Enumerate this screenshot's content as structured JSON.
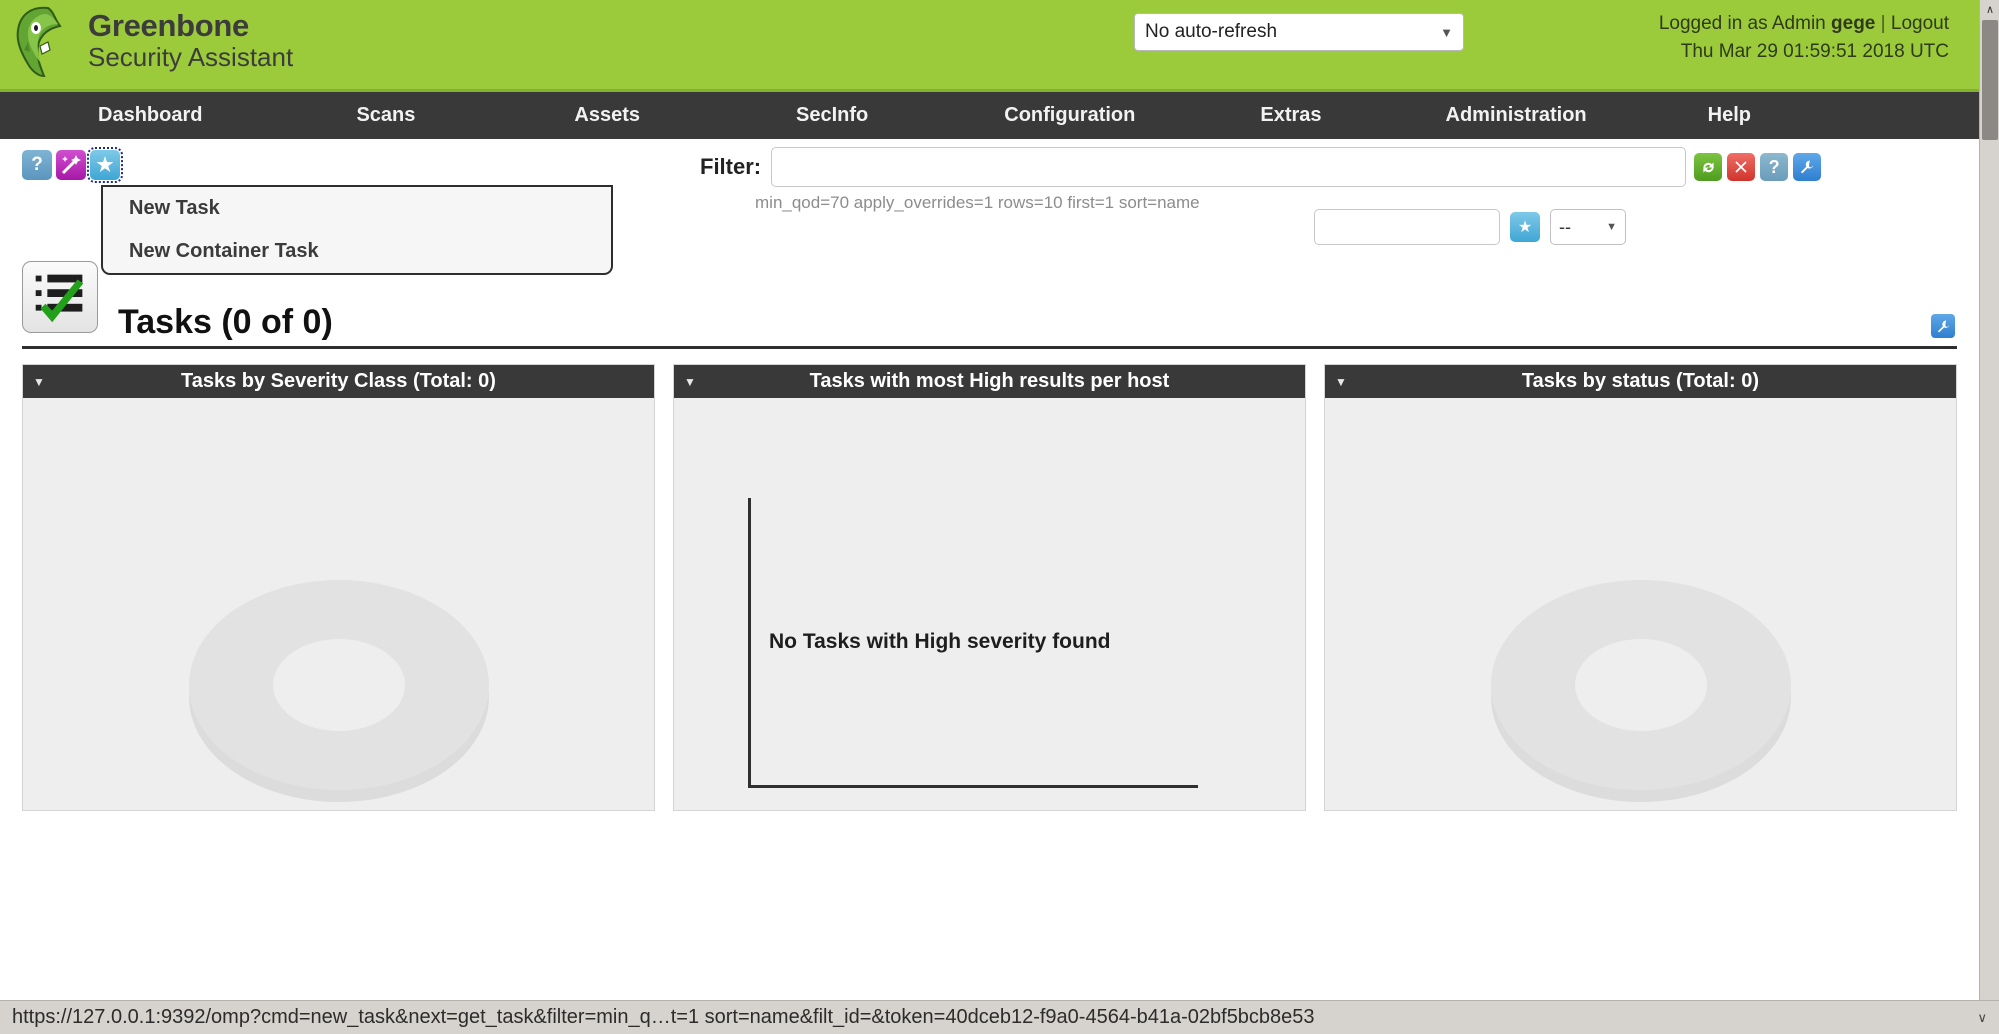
{
  "header": {
    "brand_line1": "Greenbone",
    "brand_line2": "Security Assistant",
    "brand_color": "#9bcb3b",
    "refresh_select": {
      "value": "No auto-refresh",
      "caret": "▼"
    },
    "session": {
      "logged_in_prefix": "Logged in as",
      "role": "Admin",
      "username": "gege",
      "separator": "|",
      "logout_label": "Logout",
      "datetime": "Thu Mar 29 01:59:51 2018 UTC"
    }
  },
  "nav": {
    "items": [
      {
        "label": "Dashboard"
      },
      {
        "label": "Scans"
      },
      {
        "label": "Assets"
      },
      {
        "label": "SecInfo"
      },
      {
        "label": "Configuration"
      },
      {
        "label": "Extras"
      },
      {
        "label": "Administration"
      },
      {
        "label": "Help"
      }
    ]
  },
  "toolbar": {
    "icons": [
      {
        "name": "help-icon",
        "glyph": "?"
      },
      {
        "name": "wizard-icon",
        "glyph": "✨"
      },
      {
        "name": "new-task-icon",
        "glyph": "★"
      }
    ],
    "dropdown": {
      "items": [
        {
          "label": "New Task"
        },
        {
          "label": "New Container Task"
        }
      ]
    }
  },
  "filter": {
    "label": "Filter:",
    "input_value": "",
    "input_placeholder": "",
    "description": "min_qod=70 apply_overrides=1 rows=10 first=1 sort=name",
    "actions": [
      {
        "name": "update-filter-icon",
        "glyph": "↻",
        "color": "#5ba82c"
      },
      {
        "name": "reset-filter-icon",
        "glyph": "✖",
        "color": "#d83a32"
      },
      {
        "name": "filter-help-icon",
        "glyph": "?",
        "color": "#7aa9c4"
      },
      {
        "name": "edit-filter-icon",
        "glyph": "ὒ7",
        "color": "#2f7fd0"
      }
    ],
    "named_filter_value": "",
    "named_filter_placeholder": "",
    "save_star_glyph": "★",
    "saved_select_value": "--",
    "saved_select_caret": "▼"
  },
  "section": {
    "icon_name": "task-list-icon",
    "title": "Tasks (0 of 0)",
    "edit_glyph": "ὒ7"
  },
  "dashboard": {
    "panels": [
      {
        "name": "tasks-by-severity-class",
        "caret": "▼",
        "title": "Tasks by Severity Class (Total: 0)",
        "chart_kind": "donut",
        "empty_message": ""
      },
      {
        "name": "tasks-with-most-high-results-per-host",
        "caret": "▼",
        "title": "Tasks with most High results per host",
        "chart_kind": "bar",
        "empty_message": "No Tasks with High severity found"
      },
      {
        "name": "tasks-by-status",
        "caret": "▼",
        "title": "Tasks by status (Total: 0)",
        "chart_kind": "donut",
        "empty_message": ""
      }
    ]
  },
  "chart_data": [
    {
      "type": "pie",
      "title": "Tasks by Severity Class (Total: 0)",
      "labels": [],
      "values": [],
      "total": 0,
      "legend": "none",
      "note": "Empty donut placeholder, no data"
    },
    {
      "type": "bar",
      "title": "Tasks with most High results per host",
      "categories": [],
      "values": [],
      "xlabel": "",
      "ylabel": "",
      "grid": false,
      "annotation": "No Tasks with High severity found"
    },
    {
      "type": "pie",
      "title": "Tasks by status (Total: 0)",
      "labels": [],
      "values": [],
      "total": 0,
      "legend": "none",
      "note": "Empty donut placeholder, no data"
    }
  ],
  "statusbar": {
    "url": "https://127.0.0.1:9392/omp?cmd=new_task&next=get_task&filter=min_q…t=1 sort=name&filt_id=&token=40dceb12-f9a0-4564-b41a-02bf5bcb8e53",
    "caret": "∨"
  },
  "scrollbar": {
    "up_arrow": "∧",
    "down_arrow": "∨"
  }
}
